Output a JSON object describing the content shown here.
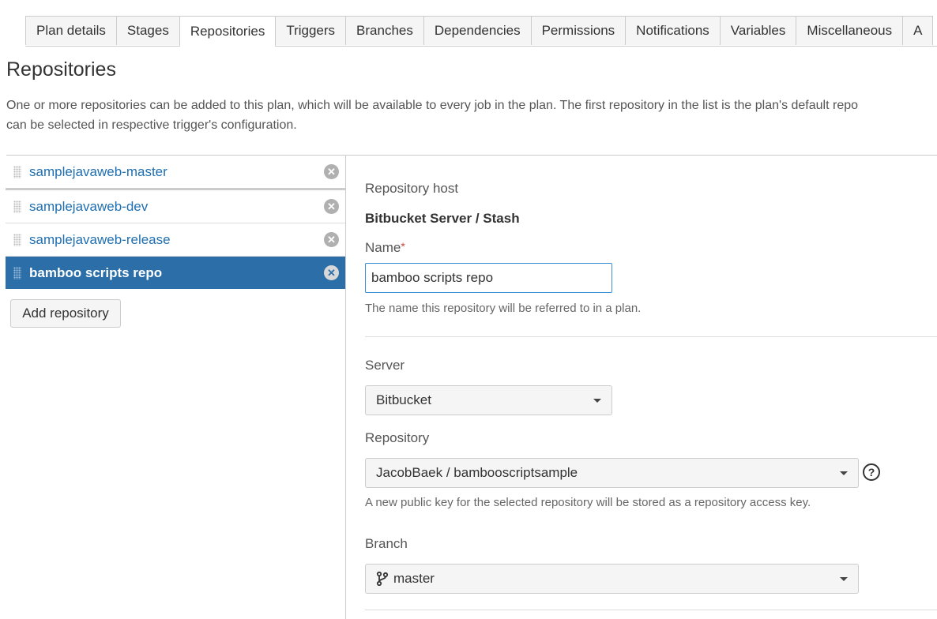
{
  "tabs": [
    {
      "label": "Plan details"
    },
    {
      "label": "Stages"
    },
    {
      "label": "Repositories"
    },
    {
      "label": "Triggers"
    },
    {
      "label": "Branches"
    },
    {
      "label": "Dependencies"
    },
    {
      "label": "Permissions"
    },
    {
      "label": "Notifications"
    },
    {
      "label": "Variables"
    },
    {
      "label": "Miscellaneous"
    },
    {
      "label": "A"
    }
  ],
  "active_tab": "Repositories",
  "page": {
    "title": "Repositories",
    "description_line1": "One or more repositories can be added to this plan, which will be available to every job in the plan. The first repository in the list is the plan's default repo",
    "description_line2": "can be selected in respective trigger's configuration."
  },
  "repositories": [
    {
      "name": "samplejavaweb-master"
    },
    {
      "name": "samplejavaweb-dev"
    },
    {
      "name": "samplejavaweb-release"
    },
    {
      "name": "bamboo scripts repo"
    }
  ],
  "selected_repository": "bamboo scripts repo",
  "add_repository_label": "Add repository",
  "remove_glyph": "✕",
  "form": {
    "host_label": "Repository host",
    "host_value": "Bitbucket Server / Stash",
    "name_label": "Name",
    "name_required_mark": "*",
    "name_value": "bamboo scripts repo",
    "name_help": "The name this repository will be referred to in a plan.",
    "server_label": "Server",
    "server_value": "Bitbucket",
    "repository_label": "Repository",
    "repository_value": "JacobBaek / bambooscriptsample",
    "repository_help_glyph": "?",
    "repository_help": "A new public key for the selected repository will be stored as a repository access key.",
    "branch_label": "Branch",
    "branch_value": "master"
  },
  "colors": {
    "accent": "#2b6ea8",
    "link": "#1f6fb0",
    "input_focus": "#3b8ed6",
    "required": "#d04437"
  }
}
